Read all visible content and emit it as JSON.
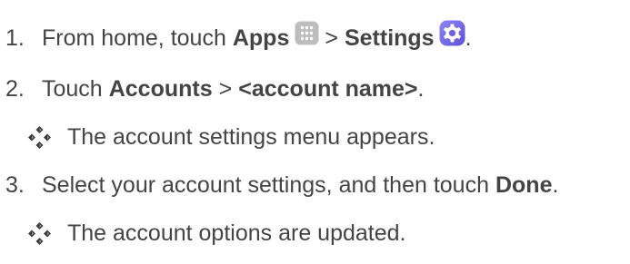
{
  "steps": [
    {
      "number": "1.",
      "text_before": "From home, touch",
      "apps_label": "Apps",
      "icon_apps": "apps-grid-icon",
      "separator": ">",
      "settings_label": "Settings",
      "icon_settings": "settings-gear-icon",
      "end": "."
    },
    {
      "number": "2.",
      "text_before": "Touch",
      "accounts_label": "Accounts",
      "separator": ">",
      "account_name": "<account name>",
      "end": "."
    },
    {
      "number": "3.",
      "text_before": "Select your account settings, and then touch",
      "done_label": "Done",
      "end": "."
    }
  ],
  "results": [
    {
      "icon": "diamond-bullet-icon",
      "text": "The account settings menu appears."
    },
    {
      "icon": "diamond-bullet-icon",
      "text": "The account options are updated."
    }
  ],
  "colors": {
    "text": "#444444",
    "apps_icon_bg": "#b8b8b8",
    "settings_icon_bg": "#7f73f0",
    "bullet": "#3a3a3a"
  }
}
